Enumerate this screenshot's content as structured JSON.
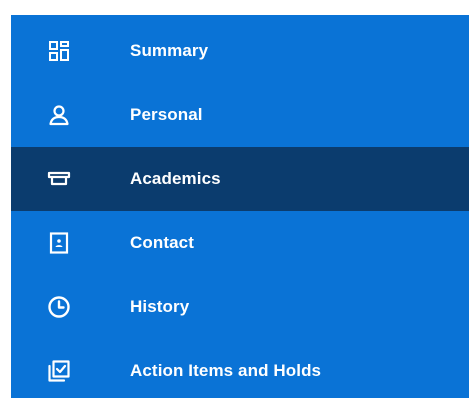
{
  "nav": {
    "selected": "academics",
    "items": [
      {
        "id": "summary",
        "label": "Summary",
        "icon": "grid-icon"
      },
      {
        "id": "personal",
        "label": "Personal",
        "icon": "person-icon"
      },
      {
        "id": "academics",
        "label": "Academics",
        "icon": "graduation-cap-icon"
      },
      {
        "id": "contact",
        "label": "Contact",
        "icon": "contact-book-icon"
      },
      {
        "id": "history",
        "label": "History",
        "icon": "clock-icon"
      },
      {
        "id": "action_items",
        "label": "Action Items and Holds",
        "icon": "checklist-icon"
      }
    ]
  },
  "colors": {
    "nav_background": "#0a73d6",
    "selected_background": "#0b3c6e",
    "text": "#ffffff"
  }
}
